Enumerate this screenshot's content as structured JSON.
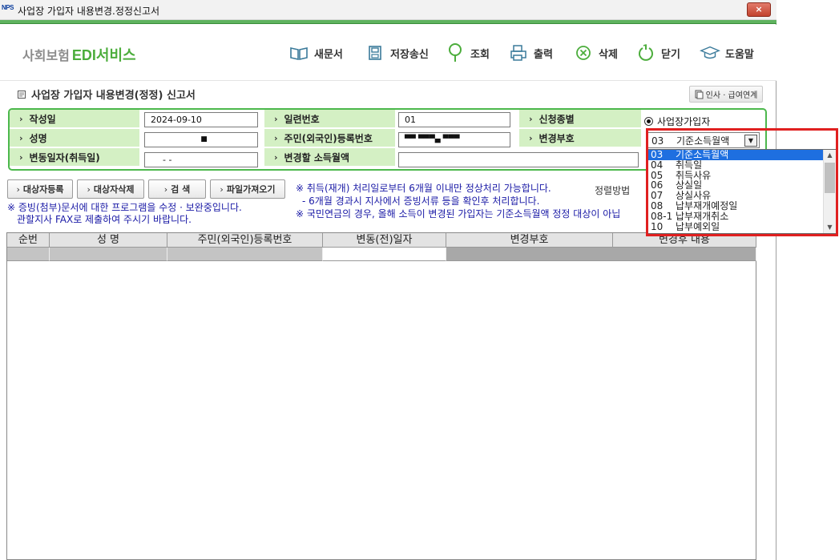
{
  "window": {
    "title": "사업장 가입자 내용변경.정정신고서",
    "app_icon": "NPS",
    "close_label": "×"
  },
  "toolbar": {
    "logo_prefix": "사회보험",
    "logo_brand": "EDI서비스",
    "buttons": [
      {
        "label": "새문서",
        "icon": "book-icon"
      },
      {
        "label": "저장송신",
        "icon": "save-icon"
      },
      {
        "label": "조회",
        "icon": "search-pin-icon"
      },
      {
        "label": "출력",
        "icon": "printer-icon"
      },
      {
        "label": "삭제",
        "icon": "delete-circle-icon"
      },
      {
        "label": "닫기",
        "icon": "power-icon"
      },
      {
        "label": "도움말",
        "icon": "graduation-cap-icon"
      }
    ]
  },
  "form": {
    "title": "사업장 가입자 내용변경(정정) 신고서",
    "link_button": "인사 · 급여연계",
    "labels": {
      "written_date": "작성일",
      "serial_no": "일련번호",
      "request_type": "신청종별",
      "name": "성명",
      "resident_no": "주민(외국인)등록번호",
      "change_code": "변경부호",
      "change_date": "변동일자(취득일)",
      "new_income": "변경할 소득월액"
    },
    "values": {
      "written_date": "2024-09-10",
      "serial_no": "01",
      "request_type": "사업장가입자",
      "name": "■",
      "resident_no": "▀▀ ▀▀▀▄ ▀▀▀",
      "change_date": "-  -",
      "new_income": ""
    },
    "change_code_combo": {
      "code": "03",
      "value": "기준소득월액"
    }
  },
  "actions": {
    "register": "대상자등록",
    "delete": "대상자삭제",
    "search": "검    색",
    "import": "파일가져오기",
    "sort": "정렬방법"
  },
  "notes": {
    "left1": "※ 증빙(첨부)문서에 대한 프로그램을 수정 · 보완중입니다.",
    "left2": "관할지사 FAX로 제출하여 주시기 바랍니다.",
    "right1": "※ 취득(재개) 처리일로부터 6개월 이내만 정상처리 가능합니다.",
    "right2": "- 6개월 경과시 지사에서 증빙서류 등을 확인후 처리합니다.",
    "right3": "※ 국민연금의 경우, 올해 소득이 변경된 가입자는 기준소득월액 정정 대상이 아닙"
  },
  "grid": {
    "columns": [
      "순번",
      "성   명",
      "주민(외국인)등록번호",
      "변동(전)일자",
      "변경부호",
      "변경후 내용"
    ]
  },
  "dropdown": {
    "options": [
      {
        "code": "03",
        "label": "기준소득월액",
        "selected": true
      },
      {
        "code": "04",
        "label": "취득일",
        "selected": false
      },
      {
        "code": "05",
        "label": "취득사유",
        "selected": false
      },
      {
        "code": "06",
        "label": "상실일",
        "selected": false
      },
      {
        "code": "07",
        "label": "상실사유",
        "selected": false
      },
      {
        "code": "08",
        "label": "납부재개예정일",
        "selected": false
      },
      {
        "code": "08-1",
        "label": "납부재개취소",
        "selected": false
      },
      {
        "code": "10",
        "label": "납부예외일",
        "selected": false
      }
    ]
  },
  "colors": {
    "accent_green": "#4cb84c",
    "label_bg": "#d4f0c4",
    "highlight_red": "#e02020",
    "selection_blue": "#1e6fe0"
  }
}
